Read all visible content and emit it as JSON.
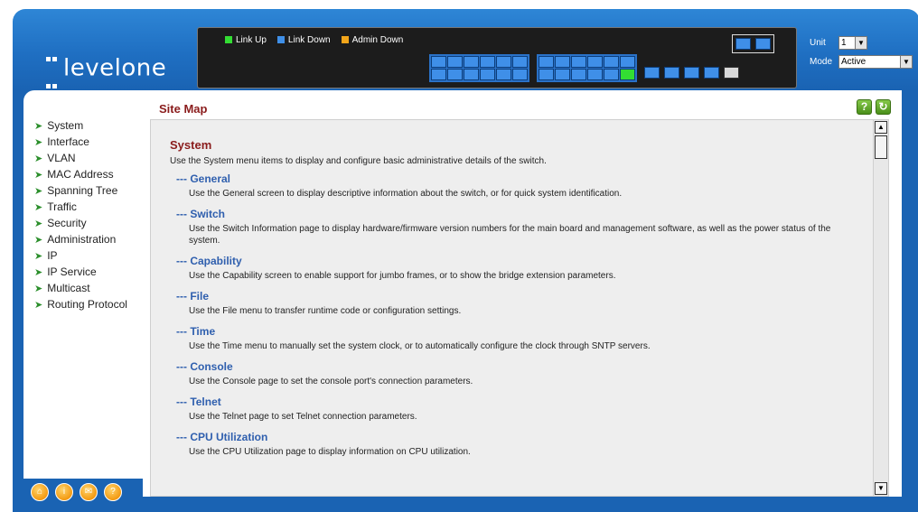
{
  "header": {
    "logo_text": "levelone",
    "legend": [
      {
        "label": "Link Up",
        "color": "#33dd33"
      },
      {
        "label": "Link Down",
        "color": "#3f8fe8"
      },
      {
        "label": "Admin Down",
        "color": "#f2a51a"
      }
    ],
    "unit_label": "Unit",
    "unit_value": "1",
    "mode_label": "Mode",
    "mode_value": "Active"
  },
  "sidebar": {
    "items": [
      {
        "label": "System"
      },
      {
        "label": "Interface"
      },
      {
        "label": "VLAN"
      },
      {
        "label": "MAC Address"
      },
      {
        "label": "Spanning Tree"
      },
      {
        "label": "Traffic"
      },
      {
        "label": "Security"
      },
      {
        "label": "Administration"
      },
      {
        "label": "IP"
      },
      {
        "label": "IP Service"
      },
      {
        "label": "Multicast"
      },
      {
        "label": "Routing Protocol"
      }
    ],
    "bottom_icons": [
      "home-icon",
      "info-icon",
      "mail-icon",
      "help-icon"
    ]
  },
  "main": {
    "title": "Site Map",
    "help_glyph": "?",
    "refresh_glyph": "↻",
    "section_title": "System",
    "section_desc": "Use the System menu items to display and configure basic administrative details of the switch.",
    "entries": [
      {
        "title": "--- General",
        "desc": "Use the General screen to display descriptive information about the switch, or for quick system identification."
      },
      {
        "title": "--- Switch",
        "desc": "Use the Switch Information page to display hardware/firmware version numbers for the main board and management software, as well as the power status of the system."
      },
      {
        "title": "--- Capability",
        "desc": "Use the Capability screen to enable support for jumbo frames, or to show the bridge extension parameters."
      },
      {
        "title": "--- File",
        "desc": "Use the File menu to transfer runtime code or configuration settings."
      },
      {
        "title": "--- Time",
        "desc": "Use the Time menu to manually set the system clock, or to automatically configure the clock through SNTP servers."
      },
      {
        "title": "--- Console",
        "desc": "Use the Console page to set the console port's connection parameters."
      },
      {
        "title": "--- Telnet",
        "desc": "Use the Telnet page to set Telnet connection parameters."
      },
      {
        "title": "--- CPU Utilization",
        "desc": "Use the CPU Utilization page to display information on CPU utilization."
      }
    ]
  }
}
